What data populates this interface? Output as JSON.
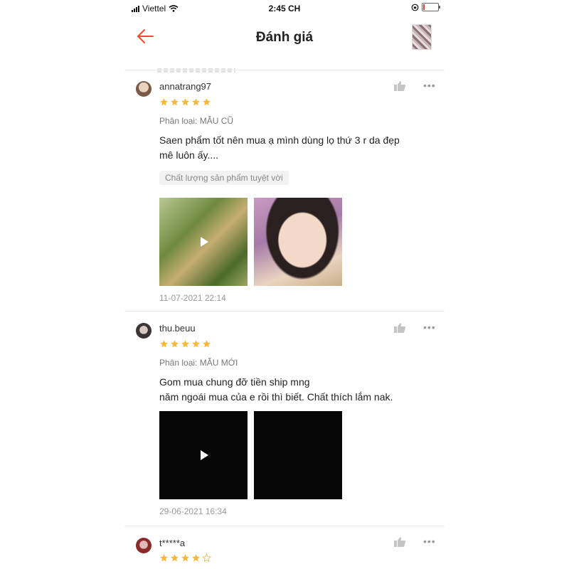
{
  "status_bar": {
    "carrier": "Viettel",
    "time": "2:45 CH",
    "battery_level": 0.1
  },
  "header": {
    "title": "Đánh giá",
    "back_icon": "arrow-left-icon"
  },
  "colors": {
    "accent": "#ee4d2d",
    "star": "#f6b93b",
    "muted": "#999999"
  },
  "reviews": [
    {
      "username": "annatrang97",
      "rating": 5,
      "variant": "Phân loại: MẪU CŨ",
      "text_lines": [
        "Saen phẩm tốt nên mua ạ mình dùng lọ thứ 3 r da đẹp",
        "mê luôn ấy...."
      ],
      "tag": "Chất lượng sản phẩm tuyệt vời",
      "media": [
        {
          "kind": "video",
          "icon": "play-icon"
        },
        {
          "kind": "photo"
        }
      ],
      "date": "11-07-2021 22:14"
    },
    {
      "username": "thu.beuu",
      "rating": 5,
      "variant": "Phân loại: MẪU MỚI",
      "text_lines": [
        "Gom mua chung đỡ tiền ship mng",
        "năm ngoái mua của e rồi thì biết. Chất thích lắm nak."
      ],
      "media": [
        {
          "kind": "video",
          "icon": "play-icon"
        },
        {
          "kind": "photo"
        }
      ],
      "date": "29-06-2021 16:34"
    },
    {
      "username": "t*****a",
      "rating": 4
    }
  ]
}
